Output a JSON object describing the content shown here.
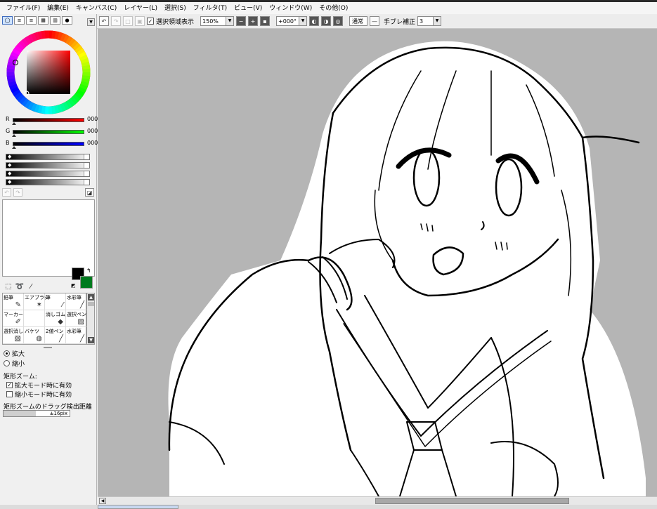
{
  "menu": [
    "ファイル(F)",
    "編集(E)",
    "キャンバス(C)",
    "レイヤー(L)",
    "選択(S)",
    "フィルタ(T)",
    "ビュー(V)",
    "ウィンドウ(W)",
    "その他(O)"
  ],
  "toolbar": {
    "selection_label": "選択領域表示",
    "zoom_value": "150%",
    "rotation_value": "+000°",
    "blend_mode": "通常",
    "stabilizer_label": "手ブレ補正",
    "stabilizer_value": "3"
  },
  "color": {
    "r_label": "R",
    "g_label": "G",
    "b_label": "B",
    "r_value": "000",
    "g_value": "000",
    "b_value": "000",
    "foreground": "#000000",
    "background": "#007a1f"
  },
  "brushes": [
    {
      "label": "鉛筆",
      "icon": "pencil-icon"
    },
    {
      "label": "エアブラシ",
      "icon": "airbrush-icon"
    },
    {
      "label": "筆",
      "icon": "brush-icon"
    },
    {
      "label": "水彩筆",
      "icon": "watercolor-icon"
    },
    {
      "label": "マーカー",
      "icon": "marker-icon"
    },
    {
      "label": "",
      "icon": ""
    },
    {
      "label": "消しゴム",
      "icon": "eraser-icon"
    },
    {
      "label": "選択ペン",
      "icon": "select-pen-icon"
    },
    {
      "label": "選択消し",
      "icon": "select-eraser-icon"
    },
    {
      "label": "バケツ",
      "icon": "bucket-icon"
    },
    {
      "label": "2値ペン",
      "icon": "binary-pen-icon"
    },
    {
      "label": "水彩筆",
      "icon": "watercolor-icon"
    }
  ],
  "zoom_options": {
    "zoom_in": "拡大",
    "zoom_out": "縮小",
    "rect_zoom_title": "矩形ズーム:",
    "enable_in_zoom_in": "拡大モード時に有効",
    "enable_in_zoom_out": "縮小モード時に有効",
    "drag_distance_title": "矩形ズームのドラッグ検出距離",
    "drag_distance_value": "±16pix"
  }
}
